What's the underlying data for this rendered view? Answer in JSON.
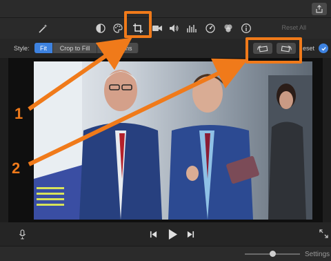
{
  "toolbar": {
    "reset_all_label": "Reset All",
    "icons": [
      "magic-wand-icon",
      "color-balance-icon",
      "color-palette-icon",
      "crop-icon",
      "stabilization-icon",
      "volume-icon",
      "equalizer-icon",
      "speed-icon",
      "filter-icon",
      "info-icon"
    ]
  },
  "style_bar": {
    "label": "Style:",
    "options": [
      "Fit",
      "Crop to Fill",
      "Ken Burns"
    ],
    "selected": "Fit",
    "reset_label": "eset"
  },
  "bottom_bar": {
    "settings_label": "Settings"
  },
  "annotations": {
    "callout_1": "1",
    "callout_2": "2",
    "highlight_color": "#f07a1a"
  },
  "colors": {
    "accent": "#3d82e0",
    "background": "#1e1e1e"
  }
}
